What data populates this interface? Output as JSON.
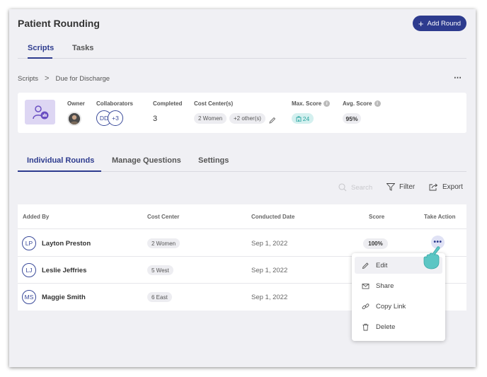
{
  "header": {
    "title": "Patient Rounding",
    "add_button": "Add Round"
  },
  "top_tabs": [
    {
      "label": "Scripts",
      "active": true
    },
    {
      "label": "Tasks",
      "active": false
    }
  ],
  "breadcrumb": {
    "root": "Scripts",
    "separator": ">",
    "current": "Due for Discharge"
  },
  "more_menu": "⋯",
  "info_card": {
    "owner_label": "Owner",
    "collaborators_label": "Collaborators",
    "collaborators": [
      "DD",
      "+3"
    ],
    "completed_label": "Completed",
    "completed_value": "3",
    "cost_centers_label": "Cost Center(s)",
    "cost_centers": [
      "2 Women",
      "+2 other(s)"
    ],
    "max_score_label": "Max. Score",
    "max_score_value": "24",
    "avg_score_label": "Avg. Score",
    "avg_score_value": "95%",
    "info_glyph": "i"
  },
  "sub_tabs": [
    {
      "label": "Individual Rounds",
      "active": true
    },
    {
      "label": "Manage Questions",
      "active": false
    },
    {
      "label": "Settings",
      "active": false
    }
  ],
  "toolbar": {
    "search_placeholder": "Search",
    "filter_label": "Filter",
    "export_label": "Export"
  },
  "table": {
    "columns": [
      "Added By",
      "Cost Center",
      "Conducted Date",
      "Score",
      "Take Action"
    ],
    "rows": [
      {
        "initials": "LP",
        "name": "Layton Preston",
        "cost_center": "2 Women",
        "date": "Sep 1, 2022",
        "score": "100%"
      },
      {
        "initials": "LJ",
        "name": "Leslie Jeffries",
        "cost_center": "5 West",
        "date": "Sep 1, 2022",
        "score": ""
      },
      {
        "initials": "MS",
        "name": "Maggie Smith",
        "cost_center": "6 East",
        "date": "Sep 1, 2022",
        "score": ""
      }
    ],
    "action_glyph": "•••"
  },
  "action_menu": {
    "items": [
      "Edit",
      "Share",
      "Copy Link",
      "Delete"
    ]
  },
  "colors": {
    "brand": "#2d3b8e",
    "teal": "#2aa5a0",
    "hand": "#5cc6c4"
  }
}
